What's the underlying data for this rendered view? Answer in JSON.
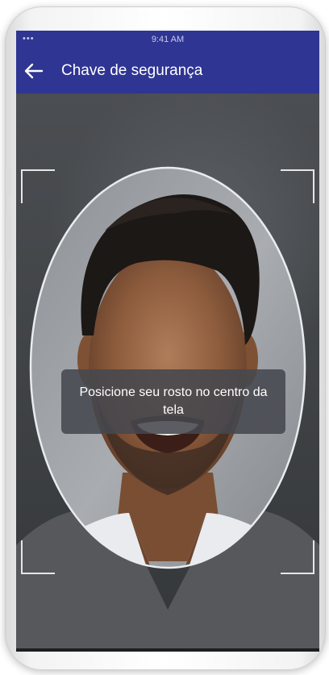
{
  "status_bar": {
    "signal": "••• ",
    "time": "9:41 AM"
  },
  "app_bar": {
    "title": "Chave de segurança",
    "back_icon": "arrow-left-icon"
  },
  "camera": {
    "instruction": "Posicione seu rosto no centro da tela"
  },
  "colors": {
    "primary": "#2f3592",
    "overlay": "#46484e",
    "frame": "#e6e6e6"
  }
}
